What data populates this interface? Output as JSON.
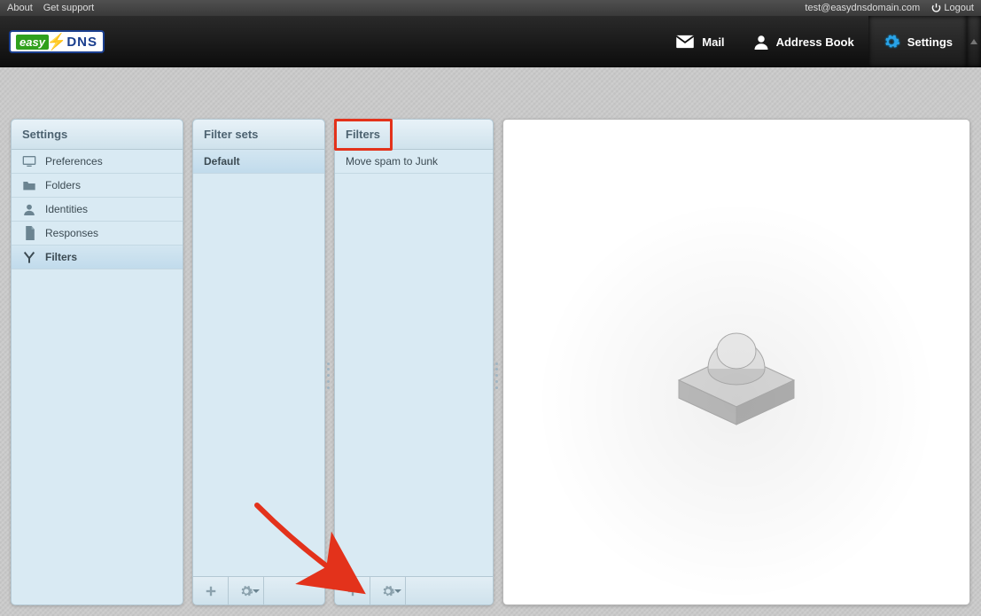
{
  "utilbar": {
    "about": "About",
    "support": "Get support",
    "user_email": "test@easydnsdomain.com",
    "logout": "Logout"
  },
  "logo": {
    "easy": "easy",
    "dns": "DNS"
  },
  "tabs": {
    "mail": "Mail",
    "addressbook": "Address Book",
    "settings": "Settings"
  },
  "panels": {
    "settings_title": "Settings",
    "filtersets_title": "Filter sets",
    "filters_title": "Filters"
  },
  "settings_nav": [
    {
      "icon": "monitor-icon",
      "label": "Preferences"
    },
    {
      "icon": "folder-icon",
      "label": "Folders"
    },
    {
      "icon": "person-icon",
      "label": "Identities"
    },
    {
      "icon": "doc-icon",
      "label": "Responses"
    },
    {
      "icon": "filter-icon",
      "label": "Filters",
      "selected": true
    }
  ],
  "filter_sets": [
    {
      "label": "Default",
      "selected": true
    }
  ],
  "filters": [
    {
      "label": "Move spam to Junk"
    }
  ]
}
